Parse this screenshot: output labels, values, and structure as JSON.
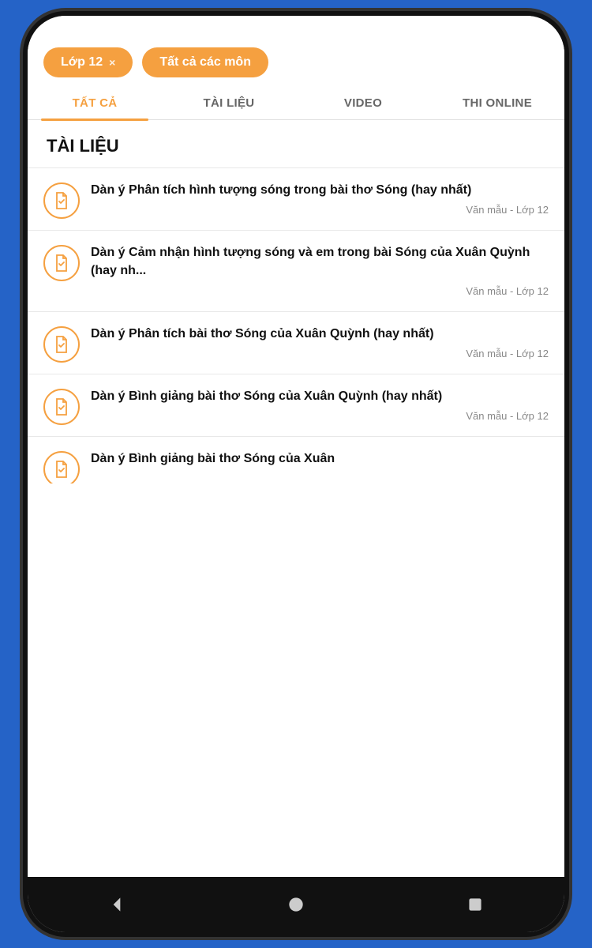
{
  "filters": {
    "grade_label": "Lớp 12",
    "grade_close": "×",
    "subject_label": "Tất cả các môn"
  },
  "tabs": [
    {
      "id": "all",
      "label": "TẤT CẢ",
      "active": true
    },
    {
      "id": "documents",
      "label": "TÀI LIỆU",
      "active": false
    },
    {
      "id": "video",
      "label": "VIDEO",
      "active": false
    },
    {
      "id": "online-test",
      "label": "THI ONLINE",
      "active": false
    }
  ],
  "section": {
    "title": "TÀI LIỆU"
  },
  "items": [
    {
      "title": "Dàn ý Phân tích hình tượng sóng trong bài thơ Sóng  (hay nhất)",
      "meta": "Văn mẫu - Lớp 12"
    },
    {
      "title": "Dàn ý Cảm nhận hình tượng sóng và em trong bài Sóng của Xuân Quỳnh  (hay nh...",
      "meta": "Văn mẫu - Lớp 12"
    },
    {
      "title": "Dàn ý Phân tích bài thơ Sóng của Xuân Quỳnh  (hay nhất)",
      "meta": "Văn mẫu - Lớp 12"
    },
    {
      "title": "Dàn ý Bình giảng bài thơ Sóng của Xuân Quỳnh  (hay nhất)",
      "meta": "Văn mẫu - Lớp 12"
    },
    {
      "title": "Dàn ý Bình giảng bài thơ Sóng của Xuân",
      "meta": ""
    }
  ],
  "bottom_nav": {
    "back_icon": "◀",
    "home_icon": "●",
    "recent_icon": "■"
  }
}
